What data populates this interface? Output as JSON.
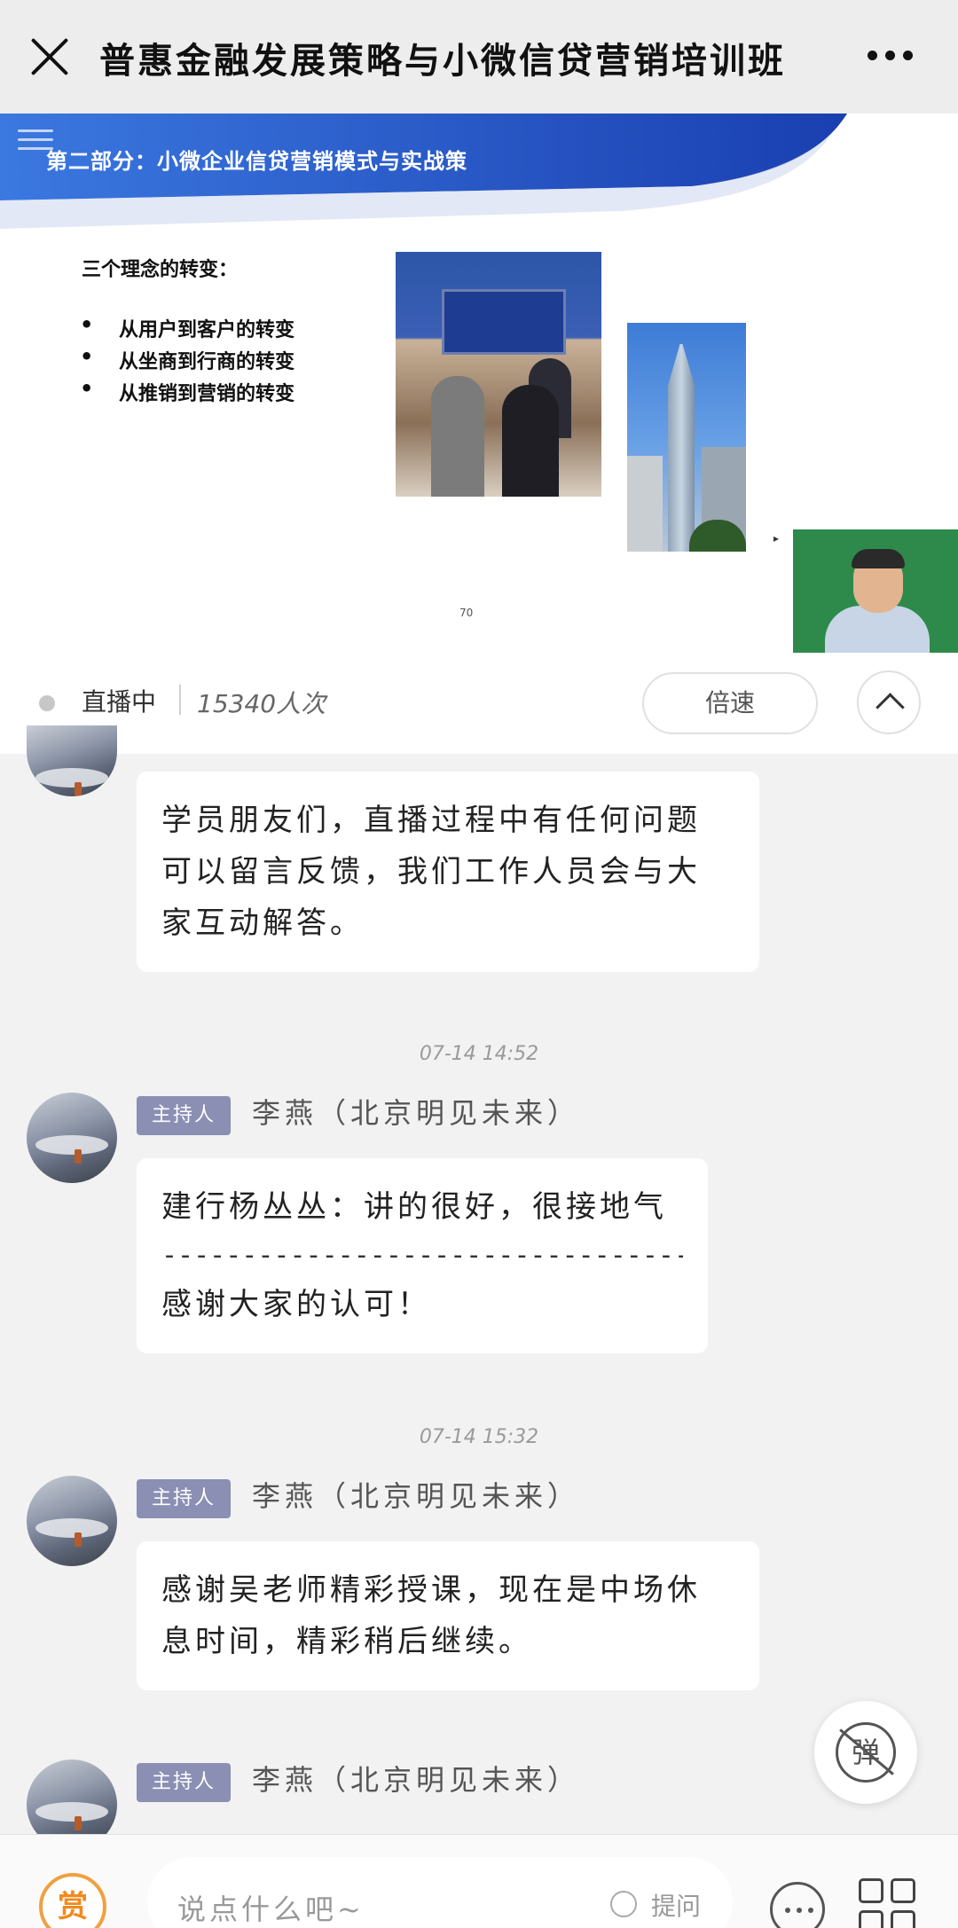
{
  "header": {
    "title": "普惠金融发展策略与小微信贷营销培训班"
  },
  "slide": {
    "banner_title": "第二部分：小微企业信贷营销模式与实战策",
    "heading": "三个理念的转变：",
    "bullets": [
      "从用户到客户的转变",
      "从坐商到行商的转变",
      "从推销到营销的转变"
    ],
    "page_number": "70"
  },
  "status": {
    "live_label": "直播中",
    "viewer_count": "15340人次",
    "speed_label": "倍速"
  },
  "messages": [
    {
      "text_lines": [
        "学员朋友们，直播过程中有任何问题",
        "可以留言反馈，我们工作人员会与大",
        "家互动解答。"
      ]
    },
    {
      "timestamp": "07-14 14:52",
      "badge": "主持人",
      "sender": "李燕（北京明见未来）",
      "line1": "建行杨丛丛：讲的很好，很接地气",
      "divider": "---------------------------------------",
      "line2": "感谢大家的认可！"
    },
    {
      "timestamp": "07-14 15:32",
      "badge": "主持人",
      "sender": "李燕（北京明见未来）",
      "text_lines": [
        "感谢吴老师精彩授课，现在是中场休",
        "息时间，精彩稍后继续。"
      ]
    },
    {
      "badge": "主持人",
      "sender": "李燕（北京明见未来）"
    }
  ],
  "danmu": {
    "label": "弹"
  },
  "input_bar": {
    "reward_label": "赏",
    "placeholder": "说点什么吧~",
    "ask_label": "提问"
  },
  "icons": {
    "close": "close-icon",
    "more": "more-dots-icon",
    "collapse": "chevron-up-icon",
    "chat": "chat-bubble-icon",
    "apps": "grid-icon"
  },
  "colors": {
    "banner_blue": "#2f5fd0",
    "host_badge": "#8a8fb3",
    "reward_orange": "#f08a1e"
  }
}
